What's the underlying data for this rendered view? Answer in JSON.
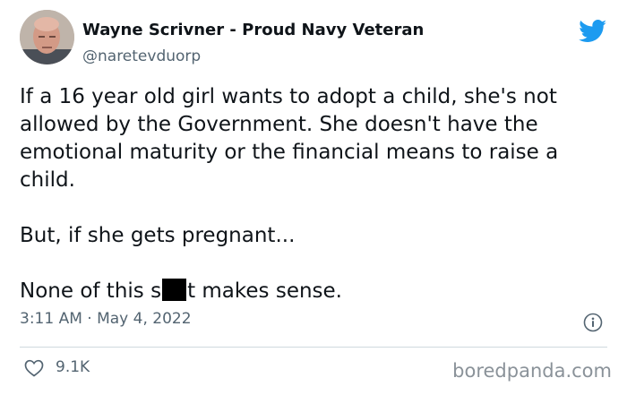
{
  "author": {
    "display_name": "Wayne Scrivner - Proud Navy Veteran",
    "handle": "@naretevduorp"
  },
  "tweet": {
    "lines": [
      "If a 16 year old girl wants to adopt a child, she's not allowed by the Government. She doesn't have the emotional maturity or the financial means to raise a child.",
      "But, if she gets pregnant..."
    ],
    "last_line_before": "None of this s",
    "last_line_after": "t makes sense."
  },
  "meta": {
    "timestamp": "3:11 AM · May 4, 2022"
  },
  "engagement": {
    "likes": "9.1K"
  },
  "watermark": "boredpanda.com",
  "colors": {
    "twitter_blue": "#1d9bf0",
    "secondary_text": "#536471",
    "primary_text": "#0f1419"
  },
  "icons": [
    "avatar",
    "twitter-bird-icon",
    "info-icon",
    "heart-icon"
  ]
}
